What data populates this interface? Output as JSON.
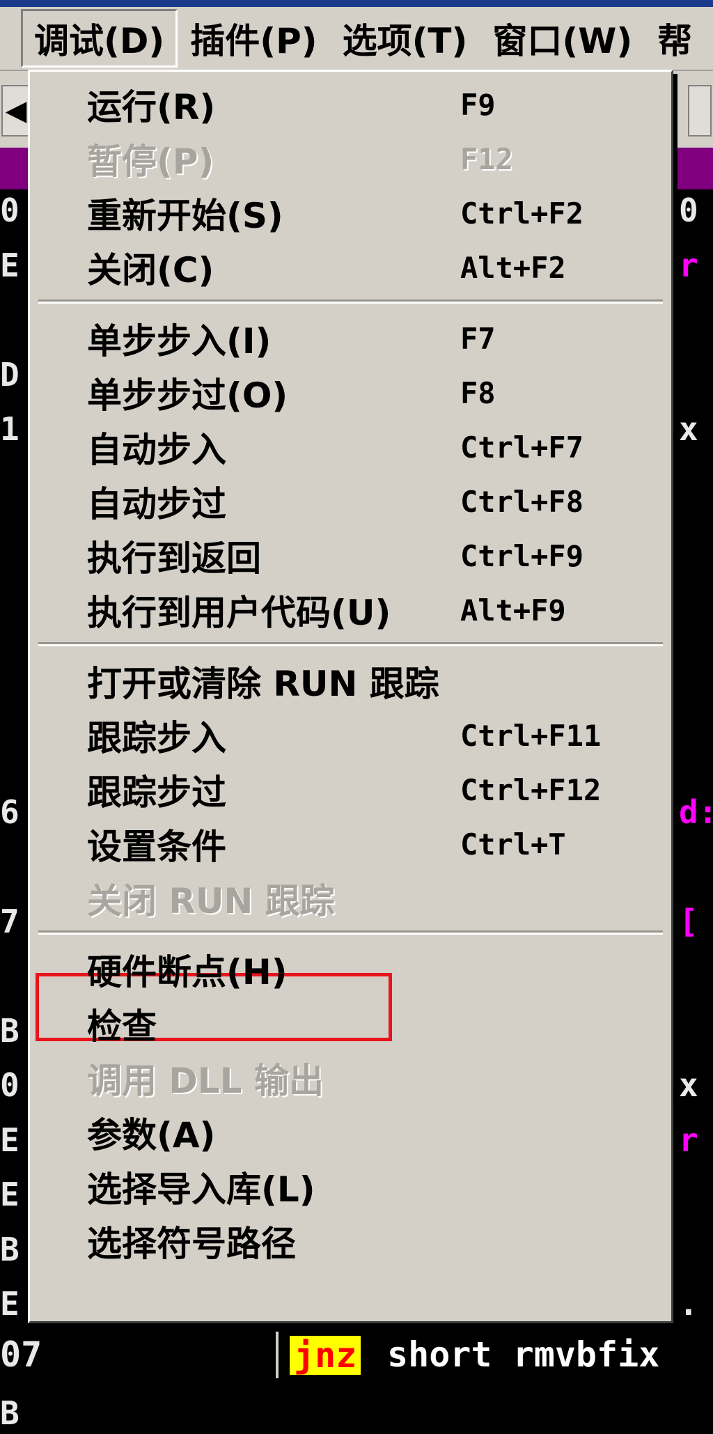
{
  "menubar": {
    "left_edge": "",
    "items": [
      {
        "label": "调试(D)",
        "active": true
      },
      {
        "label": "插件(P)",
        "active": false
      },
      {
        "label": "选项(T)",
        "active": false
      },
      {
        "label": "窗口(W)",
        "active": false
      }
    ],
    "right_edge": "帮"
  },
  "toolbar": {
    "left_arrow": "◀"
  },
  "left_column_chars": [
    {
      "text": "0",
      "row": 0
    },
    {
      "text": "E",
      "row": 1
    },
    {
      "text": "D",
      "row": 3
    },
    {
      "text": "1",
      "row": 4
    },
    {
      "text": "6",
      "row": 11
    },
    {
      "text": "7",
      "row": 13
    },
    {
      "text": "B",
      "row": 15
    },
    {
      "text": "0",
      "row": 16
    },
    {
      "text": "E",
      "row": 17
    },
    {
      "text": "E",
      "row": 18
    },
    {
      "text": "B",
      "row": 19
    },
    {
      "text": "E",
      "row": 20
    },
    {
      "text": "0",
      "row": 21
    },
    {
      "text": "B",
      "row": 22
    }
  ],
  "right_column_chars": [
    {
      "text": "0",
      "row": 0,
      "color": "#e8e8e8"
    },
    {
      "text": "r",
      "row": 1,
      "color": "#ff00ff"
    },
    {
      "text": "x",
      "row": 4,
      "color": "#e8e8e8"
    },
    {
      "text": "d:",
      "row": 11,
      "color": "#ff00ff"
    },
    {
      "text": "[",
      "row": 13,
      "color": "#ff00ff"
    },
    {
      "text": "x",
      "row": 16,
      "color": "#e8e8e8"
    },
    {
      "text": "r",
      "row": 17,
      "color": "#ff00ff"
    },
    {
      "text": ".",
      "row": 20,
      "color": "#e8e8e8"
    }
  ],
  "menu": {
    "items": [
      {
        "label": "运行(R)",
        "shortcut": "F9",
        "disabled": false
      },
      {
        "label": "暂停(P)",
        "shortcut": "F12",
        "disabled": true
      },
      {
        "label": "重新开始(S)",
        "shortcut": "Ctrl+F2",
        "disabled": false
      },
      {
        "label": "关闭(C)",
        "shortcut": "Alt+F2",
        "disabled": false
      },
      {
        "separator": true
      },
      {
        "label": "单步步入(I)",
        "shortcut": "F7",
        "disabled": false
      },
      {
        "label": "单步步过(O)",
        "shortcut": "F8",
        "disabled": false
      },
      {
        "label": "自动步入",
        "shortcut": "Ctrl+F7",
        "disabled": false
      },
      {
        "label": "自动步过",
        "shortcut": "Ctrl+F8",
        "disabled": false
      },
      {
        "label": "执行到返回",
        "shortcut": "Ctrl+F9",
        "disabled": false
      },
      {
        "label": "执行到用户代码(U)",
        "shortcut": "Alt+F9",
        "disabled": false
      },
      {
        "separator": true
      },
      {
        "label": "打开或清除 RUN 跟踪",
        "shortcut": "",
        "disabled": false
      },
      {
        "label": "跟踪步入",
        "shortcut": "Ctrl+F11",
        "disabled": false
      },
      {
        "label": "跟踪步过",
        "shortcut": "Ctrl+F12",
        "disabled": false
      },
      {
        "label": "设置条件",
        "shortcut": "Ctrl+T",
        "disabled": false
      },
      {
        "label": "关闭 RUN 跟踪",
        "shortcut": "",
        "disabled": true
      },
      {
        "separator": true
      },
      {
        "label": "硬件断点(H)",
        "shortcut": "",
        "disabled": false,
        "highlighted": true
      },
      {
        "label": "检查",
        "shortcut": "",
        "disabled": false
      },
      {
        "label": "调用 DLL 输出",
        "shortcut": "",
        "disabled": true
      },
      {
        "label": "参数(A)",
        "shortcut": "",
        "disabled": false
      },
      {
        "label": "选择导入库(L)",
        "shortcut": "",
        "disabled": false
      },
      {
        "label": "选择符号路径",
        "shortcut": "",
        "disabled": false
      }
    ]
  },
  "code_line": {
    "address": "07",
    "mnemonic": "jnz",
    "operand": "short rmvbfix"
  },
  "colors": {
    "menu_bg": "#d4d0c8",
    "title_bar": "#1b3a8c",
    "code_bg": "#000000",
    "purple_band": "#800080",
    "highlight_box": "#e8141c",
    "mnemonic_bg": "#ffff00",
    "mnemonic_fg": "#ff0000"
  }
}
